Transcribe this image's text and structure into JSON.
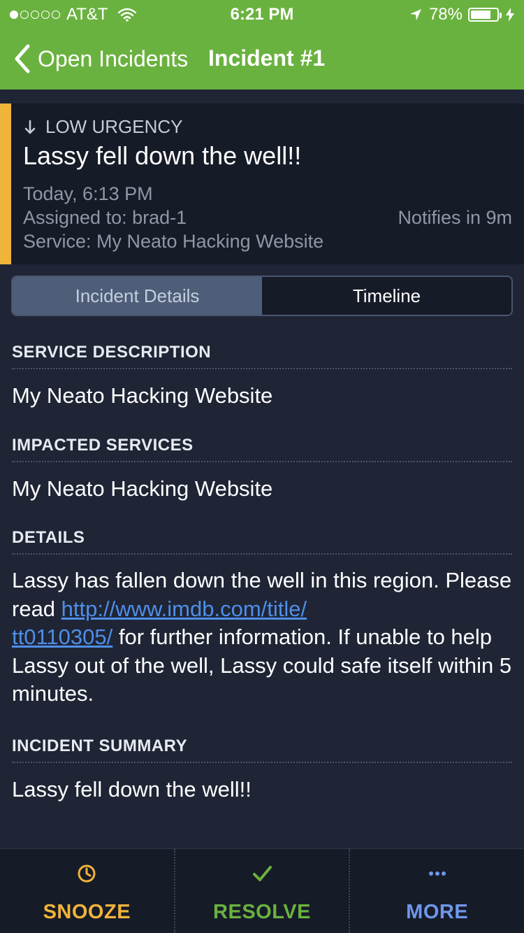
{
  "status_bar": {
    "carrier": "AT&T",
    "time": "6:21 PM",
    "battery": "78%",
    "battery_level": 0.78,
    "signal_bars_filled": 1,
    "signal_bars_total": 5
  },
  "nav": {
    "back_label": "Open Incidents",
    "title": "Incident #1"
  },
  "incident": {
    "urgency": "LOW URGENCY",
    "title": "Lassy fell down the well!!",
    "time": "Today, 6:13 PM",
    "assigned": "Assigned to: brad-1",
    "service": "Service: My Neato Hacking Website",
    "notifies": "Notifies in 9m",
    "urgency_color": "#f0b43a"
  },
  "tabs": [
    {
      "label": "Incident Details",
      "active": true
    },
    {
      "label": "Timeline",
      "active": false
    }
  ],
  "sections": {
    "service_description": {
      "heading": "SERVICE DESCRIPTION",
      "body": "My Neato Hacking Website"
    },
    "impacted_services": {
      "heading": "IMPACTED SERVICES",
      "body": "My Neato Hacking Website"
    },
    "details": {
      "heading": "DETAILS",
      "text_before": "Lassy has fallen down the well in this region. Please read ",
      "link_line1": "http://www.imdb.com/title/",
      "link_line2": "tt0110305/",
      "text_after": " for further information. If unable to help Lassy out of the well, Lassy could safe itself within 5 minutes."
    },
    "incident_summary": {
      "heading": "INCIDENT SUMMARY",
      "body": "Lassy fell down the well!!"
    }
  },
  "toolbar": {
    "snooze": {
      "label": "SNOOZE",
      "icon": "clock-icon",
      "color": "#f0b43a"
    },
    "resolve": {
      "label": "RESOLVE",
      "icon": "checkmark-icon",
      "color": "#6ab23f"
    },
    "more": {
      "label": "MORE",
      "icon": "ellipsis-icon",
      "color": "#6f97ea"
    }
  },
  "colors": {
    "header_green": "#6ab23f",
    "background": "#1f2535",
    "card_background": "#161b28",
    "link": "#4f8ee8"
  }
}
